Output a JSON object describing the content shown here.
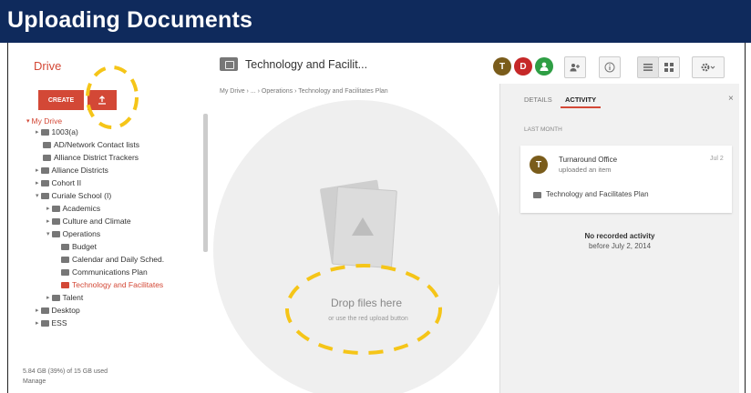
{
  "banner": {
    "title": "Uploading Documents"
  },
  "app": {
    "name": "Drive"
  },
  "header": {
    "folder_title": "Technology and Facilit...",
    "avatars": [
      {
        "letter": "T",
        "color": "#7a5c1b"
      },
      {
        "letter": "D",
        "color": "#c62828"
      },
      {
        "letter": "",
        "color": "#2e9e44"
      }
    ],
    "icons": [
      "add-person-icon",
      "info-icon",
      "list-view-icon",
      "grid-view-icon",
      "settings-icon"
    ]
  },
  "breadcrumb": "My Drive  ›  ...  ›  Operations  ›  Technology and Facilitates Plan",
  "left": {
    "create_label": "CREATE",
    "tree": [
      {
        "label": "My Drive",
        "level": 0
      },
      {
        "label": "1003(a)",
        "level": 1
      },
      {
        "label": "AD/Network Contact lists",
        "level": 1
      },
      {
        "label": "Alliance District Trackers",
        "level": 1
      },
      {
        "label": "Alliance Districts",
        "level": 1
      },
      {
        "label": "Cohort II",
        "level": 1
      },
      {
        "label": "Curiale School (I)",
        "level": 1
      },
      {
        "label": "Academics",
        "level": 2
      },
      {
        "label": "Culture and Climate",
        "level": 2
      },
      {
        "label": "Operations",
        "level": 2
      },
      {
        "label": "Budget",
        "level": 3
      },
      {
        "label": "Calendar and Daily Sched.",
        "level": 3
      },
      {
        "label": "Communications Plan",
        "level": 3
      },
      {
        "label": "Technology and Facilitates",
        "level": 3,
        "active": true
      },
      {
        "label": "Talent",
        "level": 2
      },
      {
        "label": "Desktop",
        "level": 1
      },
      {
        "label": "ESS",
        "level": 1
      }
    ],
    "storage_line1": "5.84 GB (39%) of 15 GB used",
    "storage_line2": "Manage"
  },
  "center": {
    "drop_title": "Drop files here",
    "drop_sub": "or use the red upload button"
  },
  "right": {
    "tab_details": "DETAILS",
    "tab_activity": "ACTIVITY",
    "close": "×",
    "last_month": "LAST MONTH",
    "card": {
      "avatar": "T",
      "who": "Turnaround Office",
      "what": "uploaded an item",
      "date": "Jul 2",
      "file": "Technology and Facilitates Plan"
    },
    "no_activity": "No recorded activity",
    "before": "before July 2, 2014"
  },
  "colors": {
    "accent": "#d34836",
    "annotation": "#f5c518",
    "banner": "#0f2a5c"
  }
}
